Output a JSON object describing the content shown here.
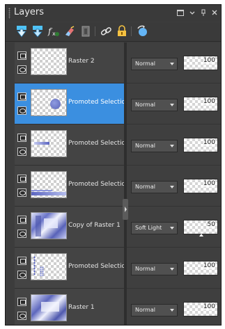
{
  "panel": {
    "title": "Layers",
    "title_buttons": [
      "maximize-icon",
      "menu-dropdown-icon",
      "pin-icon",
      "close-icon"
    ]
  },
  "toolbar": {
    "icons": [
      "new-raster-layer-icon",
      "new-vector-layer-icon",
      "fx-effects-icon",
      "eraser-icon",
      "mask-icon",
      "link-icon",
      "lock-icon",
      "refresh-icon"
    ]
  },
  "layers": [
    {
      "name": "Raster 2",
      "blend_mode": "Normal",
      "opacity": "100",
      "selected": false,
      "thumb": "empty"
    },
    {
      "name": "Promoted Selection",
      "blend_mode": "Normal",
      "opacity": "100",
      "selected": true,
      "thumb": "circle"
    },
    {
      "name": "Promoted Selection",
      "blend_mode": "Normal",
      "opacity": "100",
      "selected": false,
      "thumb": "stroke"
    },
    {
      "name": "Promoted Selection",
      "blend_mode": "Normal",
      "opacity": "100",
      "selected": false,
      "thumb": "bottom-band"
    },
    {
      "name": "Copy of Raster 1",
      "blend_mode": "Soft Light",
      "opacity": "50",
      "selected": false,
      "thumb": "blue-image"
    },
    {
      "name": "Promoted Selection",
      "blend_mode": "Normal",
      "opacity": "100",
      "selected": false,
      "thumb": "dots"
    },
    {
      "name": "Raster 1",
      "blend_mode": "Normal",
      "opacity": "100",
      "selected": false,
      "thumb": "blue-image"
    }
  ],
  "colors": {
    "panel_bg": "#3c3c3c",
    "selected_row": "#3b8fe0"
  }
}
